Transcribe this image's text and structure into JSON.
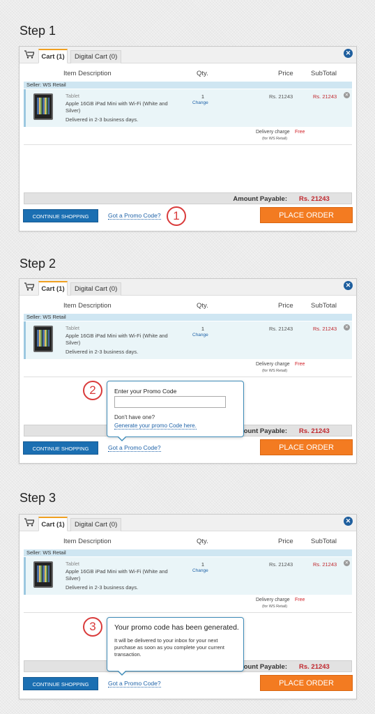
{
  "steps": [
    {
      "title": "Step 1",
      "badge": "1"
    },
    {
      "title": "Step 2",
      "badge": "2"
    },
    {
      "title": "Step 3",
      "badge": "3"
    }
  ],
  "cart": {
    "tab_cart": "Cart (1)",
    "tab_digital": "Digital Cart (0)",
    "close_icon": "✕",
    "columns": {
      "item": "Item Description",
      "qty": "Qty.",
      "price": "Price",
      "subtotal": "SubTotal"
    },
    "seller": "Seller: WS Retail",
    "item": {
      "category": "Tablet",
      "name": "Apple 16GB iPad Mini with Wi-Fi (White and Silver)",
      "delivery": "Delivered in 2-3 business days.",
      "qty": "1",
      "change": "Change",
      "price": "Rs. 21243",
      "subtotal": "Rs. 21243",
      "remove_icon": "✕"
    },
    "delivery_charge": "Delivery charge",
    "delivery_free": "Free",
    "delivery_for": "(for WS Retail)",
    "amount_label": "Amount Payable:",
    "amount_value": "Rs. 21243",
    "continue_label": "CONTINUE SHOPPING",
    "promo_link": "Got a Promo Code?",
    "place_order": "PLACE ORDER"
  },
  "promo_popup": {
    "label": "Enter your Promo Code",
    "input_value": "",
    "no_code": "Don't have one?",
    "generate_link": "Generate your promo Code here."
  },
  "generated_popup": {
    "title": "Your promo code has been generated.",
    "message": "It will be delivered to your inbox for your next purchase as soon as you complete your current transaction."
  },
  "colors": {
    "accent_orange": "#f37b21",
    "accent_blue": "#1b6fb2",
    "price_red": "#c0272d",
    "badge_red": "#d93a3a"
  }
}
